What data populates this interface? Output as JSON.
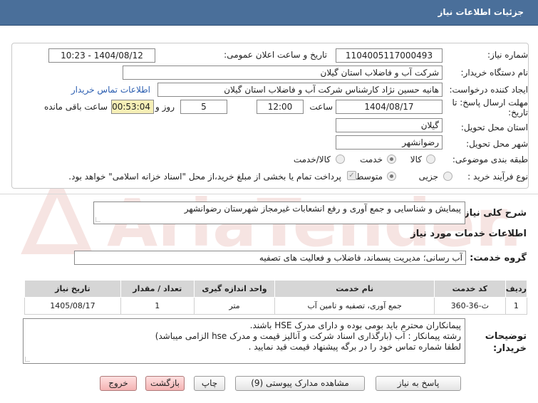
{
  "header": {
    "title": "جزئیات اطلاعات نیاز"
  },
  "form": {
    "need_number_label": "شماره نیاز:",
    "need_number": "1104005117000493",
    "announce_label": "تاریخ و ساعت اعلان عمومی:",
    "announce_value": "1404/08/12 - 10:23",
    "buyer_org_label": "نام دستگاه خریدار:",
    "buyer_org": "شرکت آب و فاضلاب استان گیلان",
    "creator_label": "ایجاد کننده درخواست:",
    "creator": "هانیه حسین نژاد کارشناس شرکت آب و فاضلاب استان گیلان",
    "contact_link": "اطلاعات تماس خریدار",
    "deadline_label_1": "مهلت ارسال پاسخ: تا",
    "deadline_label_2": "تاریخ:",
    "deadline_date": "1404/08/17",
    "time_label": "ساعت",
    "deadline_time": "12:00",
    "days_value": "5",
    "days_label": "روز و",
    "remaining_time": "00:53:04",
    "remaining_label": "ساعت باقی مانده",
    "province_label": "استان محل تحویل:",
    "province": "گیلان",
    "city_label": "شهر محل تحویل:",
    "city": "رضوانشهر",
    "category_label": "طبقه بندی موضوعی:",
    "category_options": [
      "کالا",
      "خدمت",
      "کالا/خدمت"
    ],
    "category_selected": "خدمت",
    "process_label": "نوع فرآیند خرید :",
    "process_options": [
      "جزیی",
      "متوسط"
    ],
    "process_selected": "متوسط",
    "payment_note": "پرداخت تمام یا بخشی از مبلغ خرید،از محل \"اسناد خزانه اسلامی\" خواهد بود."
  },
  "summary": {
    "label": "شرح کلی نیاز:",
    "text": "پیمایش و شناسایی و جمع آوری و رفع انشعابات غیرمجاز شهرستان رضوانشهر"
  },
  "services": {
    "section_title": "اطلاعات خدمات مورد نیاز",
    "group_label": "گروه خدمت:",
    "group_value": "آب رسانی؛ مدیریت پسماند، فاضلاب و فعالیت های تصفیه",
    "table": {
      "headers": [
        "ردیف",
        "کد خدمت",
        "نام خدمت",
        "واحد اندازه گیری",
        "تعداد / مقدار",
        "تاریخ نیاز"
      ],
      "rows": [
        [
          "1",
          "ث-36-360",
          "جمع آوری، تصفیه و تامین آب",
          "متر",
          "1",
          "1405/08/17"
        ]
      ]
    }
  },
  "notes": {
    "label_1": "توضیحات",
    "label_2": "خریدار:",
    "lines": [
      "پیمانکاران محترم باید بومی بوده و  دارای مدرک HSE باشند.",
      "رشته پیمانکار :     آب  (بارگذاری اسناد شرکت و آنالیز قیمت و مدرک hse الزامی میباشد)",
      "لطفا شماره تماس خود را در برگه پیشنهاد قیمت قید نمایید ."
    ]
  },
  "buttons": {
    "reply": "پاسخ به نیاز",
    "attachments": "مشاهده مدارک پیوستی (9)",
    "print": "چاپ",
    "back": "بازگشت",
    "exit": "خروج"
  },
  "watermark": {
    "text": "AriaTender.net"
  },
  "colors": {
    "title_bar": "#4a6f9a",
    "timer_bg": "#f6efb6",
    "link": "#2a5db0",
    "watermark": "#c0392b"
  }
}
